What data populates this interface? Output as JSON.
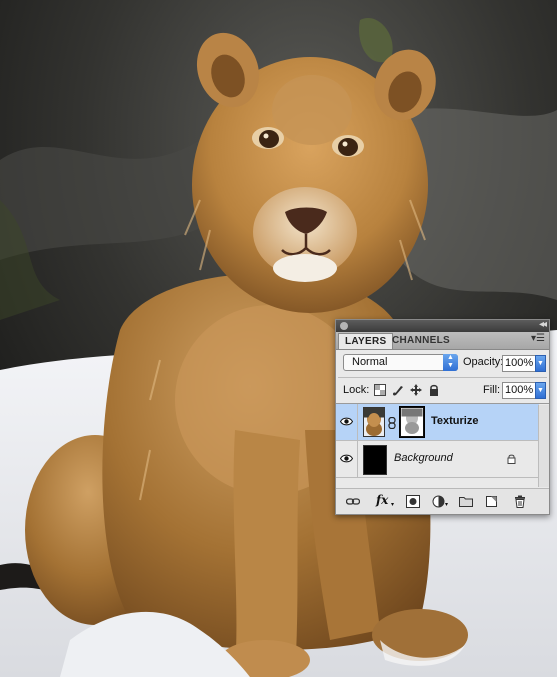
{
  "image": {
    "subject": "lion-cub-in-snow"
  },
  "panel": {
    "tabs": [
      {
        "label": "LAYERS"
      },
      {
        "label": "CHANNELS"
      }
    ],
    "blend_mode": "Normal",
    "opacity_label": "Opacity:",
    "opacity_value": "100%",
    "lock_label": "Lock:",
    "fill_label": "Fill:",
    "fill_value": "100%",
    "layers": [
      {
        "name": "Texturize"
      },
      {
        "name": "Background"
      }
    ],
    "footer_icons": [
      "link-layers-icon",
      "fx-icon",
      "layer-mask-icon",
      "adjustment-layer-icon",
      "new-group-icon",
      "new-layer-icon",
      "trash-icon"
    ],
    "fx_label": "fx"
  },
  "colors": {
    "selection": "#b6d3f7",
    "panel_bg": "#e9e9e9",
    "accent": "#2f6fd4"
  }
}
